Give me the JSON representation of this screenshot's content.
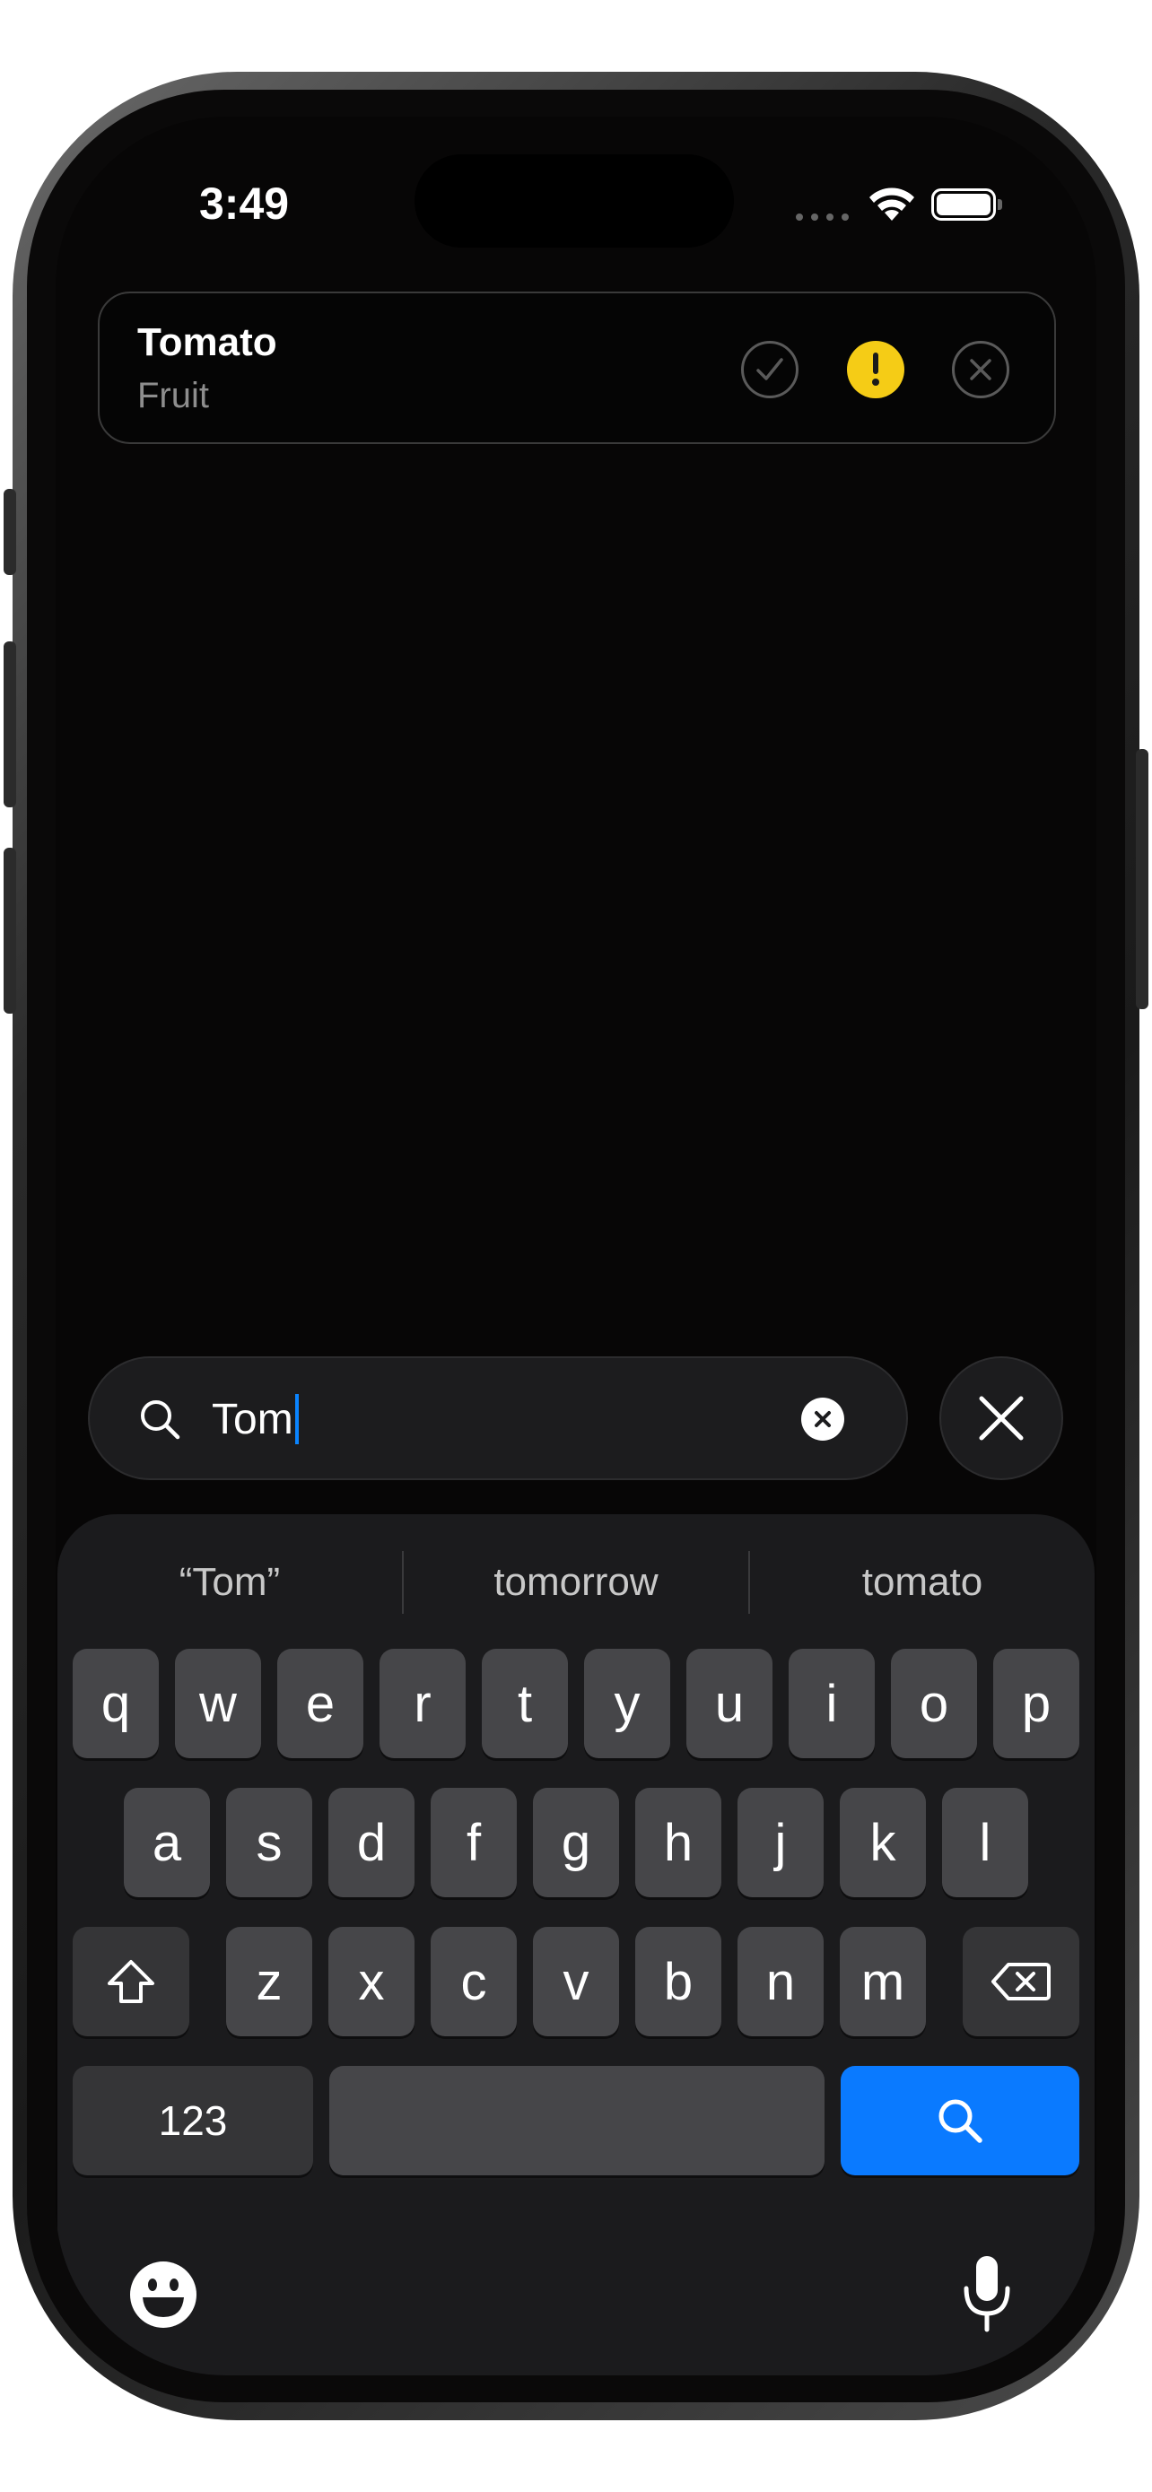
{
  "status_bar": {
    "time": "3:49"
  },
  "item": {
    "title": "Tomato",
    "subtitle": "Fruit"
  },
  "search": {
    "query": "Tom"
  },
  "suggestions": [
    "“Tom”",
    "tomorrow",
    "tomato"
  ],
  "keyboard": {
    "row1": [
      "q",
      "w",
      "e",
      "r",
      "t",
      "y",
      "u",
      "i",
      "o",
      "p"
    ],
    "row2": [
      "a",
      "s",
      "d",
      "f",
      "g",
      "h",
      "j",
      "k",
      "l"
    ],
    "row3": [
      "z",
      "x",
      "c",
      "v",
      "b",
      "n",
      "m"
    ],
    "numbers_label": "123"
  },
  "colors": {
    "accent": "#0a7aff",
    "warning": "#f5cc16",
    "background": "#070606"
  },
  "icons": [
    "checkmark-circle-icon",
    "exclamation-icon",
    "xmark-circle-icon",
    "search-icon",
    "clear-icon",
    "close-icon",
    "shift-icon",
    "delete-icon",
    "emoji-icon",
    "microphone-icon"
  ]
}
